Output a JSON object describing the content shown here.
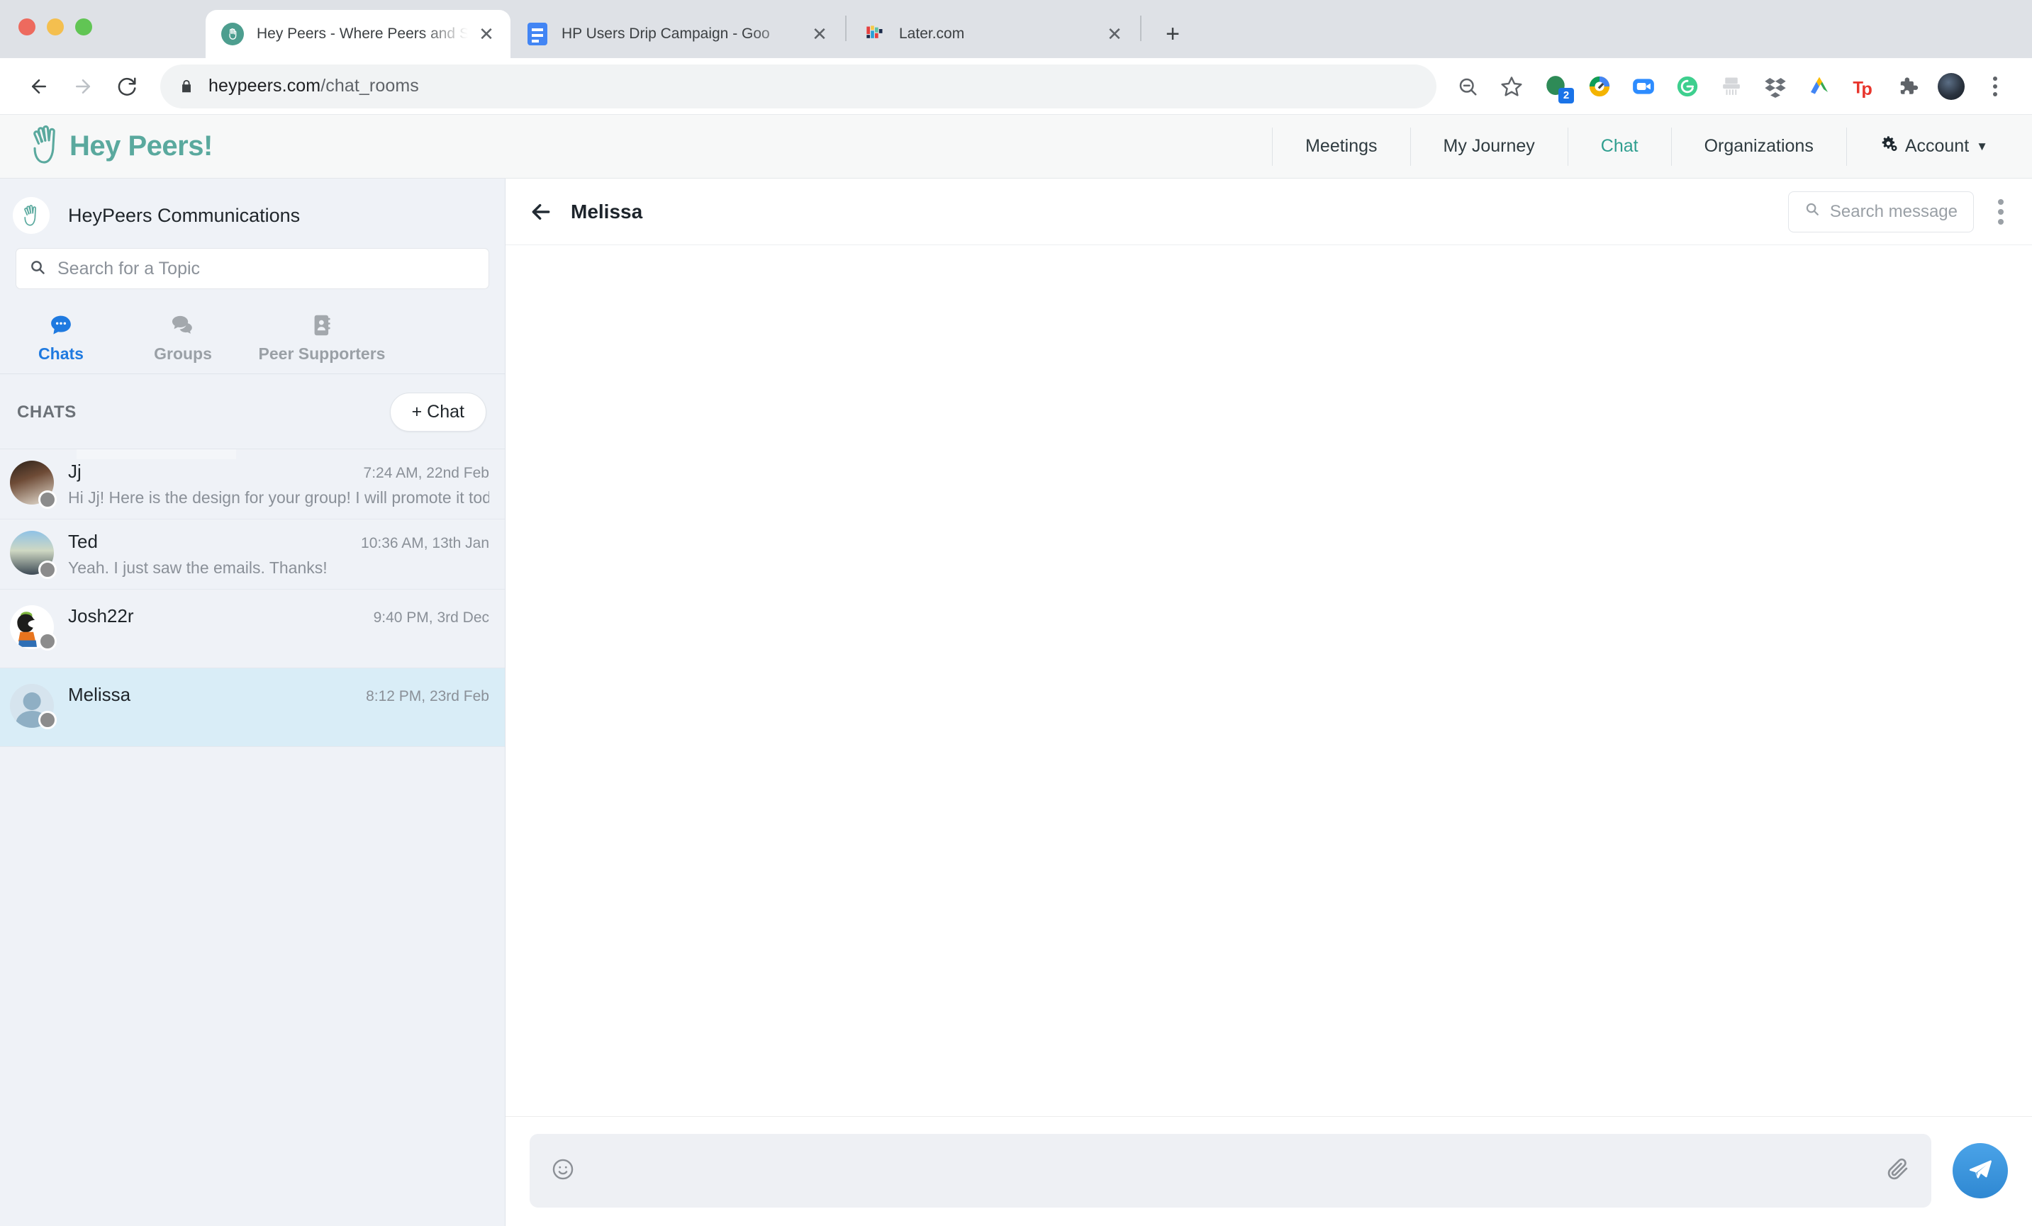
{
  "browser": {
    "tabs": [
      {
        "title": "Hey Peers - Where Peers and S",
        "favicon": "heypeers-hand-icon",
        "active": true
      },
      {
        "title": "HP Users Drip Campaign - Goo",
        "favicon": "google-docs-icon",
        "active": false
      },
      {
        "title": "Later.com",
        "favicon": "later-icon",
        "active": false
      }
    ],
    "new_tab_label": "+",
    "close_label": "✕",
    "url": {
      "domain": "heypeers.com",
      "path": "/chat_rooms"
    },
    "extensions": [
      {
        "name": "grasshopper-extension-icon",
        "badge": "2"
      },
      {
        "name": "google-drive-icon",
        "badge": ""
      },
      {
        "name": "zoom-icon",
        "badge": ""
      },
      {
        "name": "grammarly-icon",
        "badge": ""
      },
      {
        "name": "shredder-icon",
        "badge": ""
      },
      {
        "name": "dropbox-icon",
        "badge": ""
      },
      {
        "name": "google-ads-icon",
        "badge": ""
      },
      {
        "name": "teachers-pay-teachers-icon",
        "badge": ""
      },
      {
        "name": "puzzle-extensions-icon",
        "badge": ""
      }
    ]
  },
  "app": {
    "brand": "Hey Peers!",
    "nav": [
      {
        "label": "Meetings",
        "active": false
      },
      {
        "label": "My Journey",
        "active": false
      },
      {
        "label": "Chat",
        "active": true
      },
      {
        "label": "Organizations",
        "active": false
      },
      {
        "label": "Account",
        "active": false
      }
    ],
    "accent_color": "#2f9e8f",
    "brand_color": "#5aa99e"
  },
  "sidebar": {
    "org_name": "HeyPeers Communications",
    "search": {
      "placeholder": "Search for a Topic",
      "value": ""
    },
    "tabs": [
      {
        "label": "Chats",
        "icon": "chat-bubble-icon",
        "active": true
      },
      {
        "label": "Groups",
        "icon": "groups-icon",
        "active": false
      },
      {
        "label": "Peer Supporters",
        "icon": "contact-card-icon",
        "active": false
      }
    ],
    "section_title": "CHATS",
    "add_chat_label": "+ Chat",
    "chats": [
      {
        "name": "Jj",
        "time": "7:24 AM, 22nd Feb",
        "preview": "Hi Jj! Here is the design for your group! I will promote it today and include",
        "selected": false,
        "status": "offline"
      },
      {
        "name": "Ted",
        "time": "10:36 AM, 13th Jan",
        "preview": "Yeah. I just saw the emails. Thanks!",
        "selected": false,
        "status": "offline"
      },
      {
        "name": "Josh22r",
        "time": "9:40 PM, 3rd Dec",
        "preview": "",
        "selected": false,
        "status": "offline"
      },
      {
        "name": "Melissa",
        "time": "8:12 PM, 23rd Feb",
        "preview": "",
        "selected": true,
        "status": "offline"
      }
    ],
    "selected_color": "#d9edf7"
  },
  "panel": {
    "title": "Melissa",
    "search_message_label": "Search message",
    "composer_placeholder": "",
    "composer_value": "",
    "send_color": "#3b92d8"
  }
}
